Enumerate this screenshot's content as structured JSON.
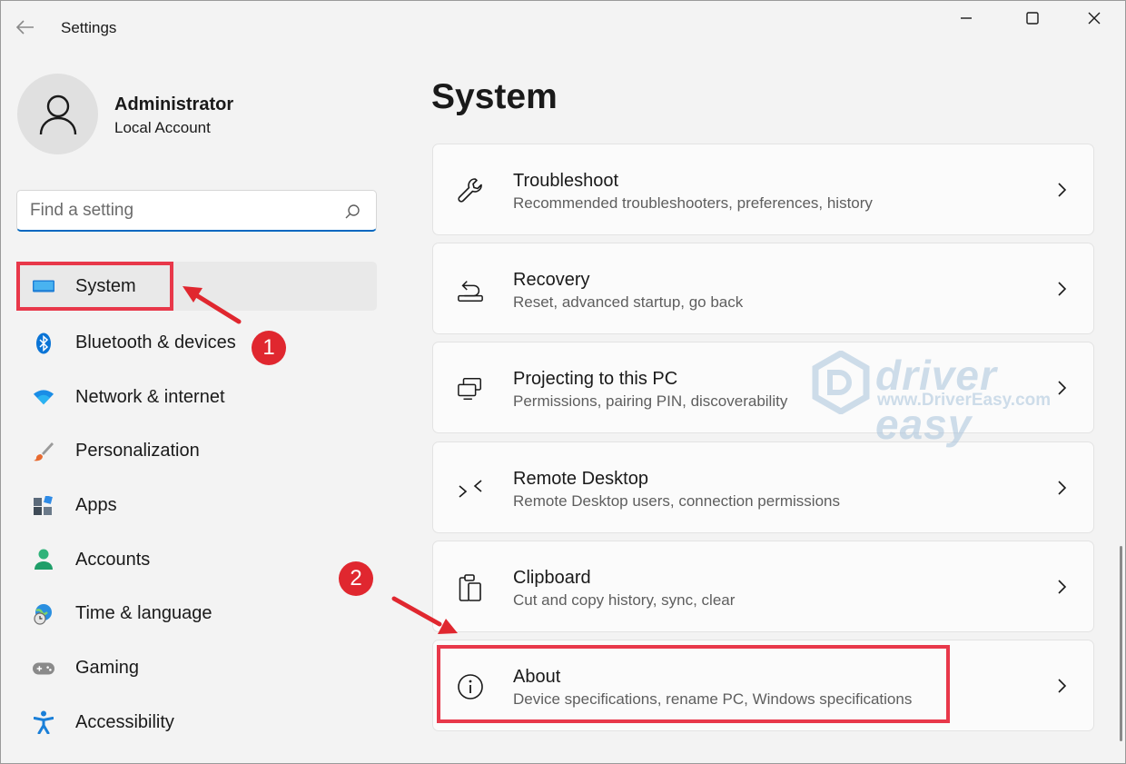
{
  "window": {
    "title": "Settings"
  },
  "account": {
    "name": "Administrator",
    "type": "Local Account"
  },
  "search": {
    "placeholder": "Find a setting",
    "value": ""
  },
  "nav": {
    "items": [
      {
        "label": "System",
        "icon": "system-display-icon",
        "selected": true
      },
      {
        "label": "Bluetooth & devices",
        "icon": "bluetooth-icon"
      },
      {
        "label": "Network & internet",
        "icon": "wifi-icon"
      },
      {
        "label": "Personalization",
        "icon": "brush-icon"
      },
      {
        "label": "Apps",
        "icon": "apps-icon"
      },
      {
        "label": "Accounts",
        "icon": "person-icon"
      },
      {
        "label": "Time & language",
        "icon": "globe-clock-icon"
      },
      {
        "label": "Gaming",
        "icon": "gamepad-icon"
      },
      {
        "label": "Accessibility",
        "icon": "accessibility-icon"
      }
    ]
  },
  "main": {
    "title": "System",
    "cards": [
      {
        "title": "Troubleshoot",
        "subtitle": "Recommended troubleshooters, preferences, history",
        "icon": "wrench-icon"
      },
      {
        "title": "Recovery",
        "subtitle": "Reset, advanced startup, go back",
        "icon": "recovery-icon"
      },
      {
        "title": "Projecting to this PC",
        "subtitle": "Permissions, pairing PIN, discoverability",
        "icon": "projecting-icon"
      },
      {
        "title": "Remote Desktop",
        "subtitle": "Remote Desktop users, connection permissions",
        "icon": "remote-desktop-icon"
      },
      {
        "title": "Clipboard",
        "subtitle": "Cut and copy history, sync, clear",
        "icon": "clipboard-icon"
      },
      {
        "title": "About",
        "subtitle": "Device specifications, rename PC, Windows specifications",
        "icon": "info-icon"
      }
    ]
  },
  "annotations": {
    "step1": "1",
    "step2": "2",
    "highlight_color": "#e8384a"
  },
  "watermark": {
    "brand": "driver easy",
    "url": "www.DriverEasy.com"
  },
  "colors": {
    "accent": "#0067c0",
    "selected_bg": "#e9e9e9",
    "badge": "#e0272f"
  }
}
